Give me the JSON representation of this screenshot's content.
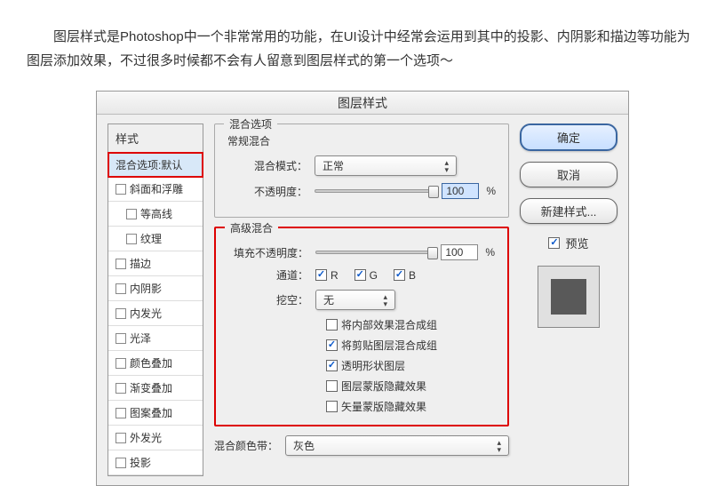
{
  "intro": "图层样式是Photoshop中一个非常常用的功能，在UI设计中经常会运用到其中的投影、内阴影和描边等功能为图层添加效果，不过很多时候都不会有人留意到图层样式的第一个选项～",
  "dialog": {
    "title": "图层样式"
  },
  "left": {
    "header": "样式",
    "selected": "混合选项:默认",
    "items": [
      {
        "label": "斜面和浮雕",
        "indent": false
      },
      {
        "label": "等高线",
        "indent": true
      },
      {
        "label": "纹理",
        "indent": true
      },
      {
        "label": "描边",
        "indent": false
      },
      {
        "label": "内阴影",
        "indent": false
      },
      {
        "label": "内发光",
        "indent": false
      },
      {
        "label": "光泽",
        "indent": false
      },
      {
        "label": "颜色叠加",
        "indent": false
      },
      {
        "label": "渐变叠加",
        "indent": false
      },
      {
        "label": "图案叠加",
        "indent": false
      },
      {
        "label": "外发光",
        "indent": false
      },
      {
        "label": "投影",
        "indent": false
      }
    ]
  },
  "center": {
    "group_title": "混合选项",
    "normal": {
      "legend": "常规混合",
      "mode_label": "混合模式：",
      "mode_value": "正常",
      "opacity_label": "不透明度：",
      "opacity_value": "100",
      "pct": "%"
    },
    "advanced": {
      "legend": "高级混合",
      "fill_label": "填充不透明度：",
      "fill_value": "100",
      "pct": "%",
      "channel_label": "通道：",
      "ch_r": "R",
      "ch_g": "G",
      "ch_b": "B",
      "knockout_label": "挖空：",
      "knockout_value": "无",
      "opts": [
        {
          "label": "将内部效果混合成组",
          "checked": false
        },
        {
          "label": "将剪贴图层混合成组",
          "checked": true
        },
        {
          "label": "透明形状图层",
          "checked": true
        },
        {
          "label": "图层蒙版隐藏效果",
          "checked": false
        },
        {
          "label": "矢量蒙版隐藏效果",
          "checked": false
        }
      ]
    },
    "blendif": {
      "label": "混合颜色带：",
      "value": "灰色"
    }
  },
  "right": {
    "ok": "确定",
    "cancel": "取消",
    "new_style": "新建样式...",
    "preview": "预览"
  }
}
